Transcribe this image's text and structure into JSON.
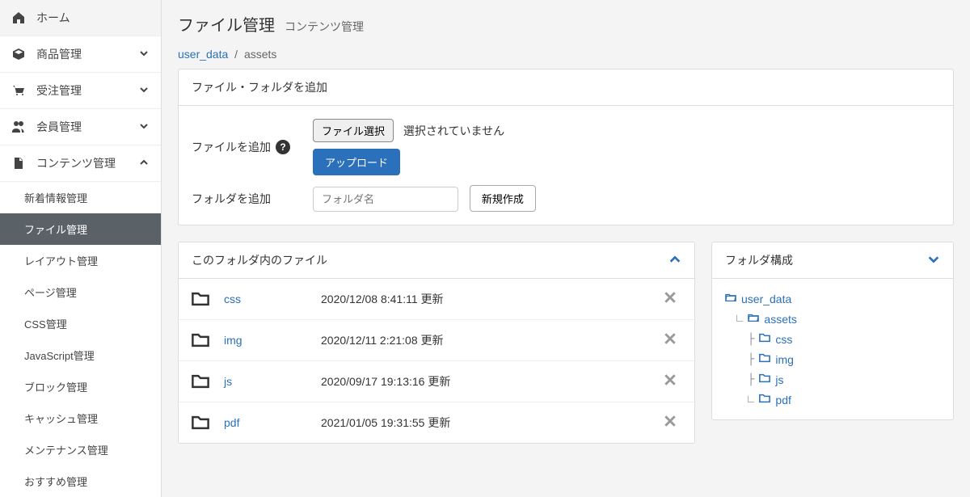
{
  "sidebar": {
    "items": [
      {
        "label": "ホーム",
        "icon": "home"
      },
      {
        "label": "商品管理",
        "icon": "cube",
        "chev": "down"
      },
      {
        "label": "受注管理",
        "icon": "cart",
        "chev": "down"
      },
      {
        "label": "会員管理",
        "icon": "users",
        "chev": "down"
      },
      {
        "label": "コンテンツ管理",
        "icon": "file",
        "chev": "up"
      }
    ],
    "sub": [
      "新着情報管理",
      "ファイル管理",
      "レイアウト管理",
      "ページ管理",
      "CSS管理",
      "JavaScript管理",
      "ブロック管理",
      "キャッシュ管理",
      "メンテナンス管理",
      "おすすめ管理"
    ],
    "active_sub": 1
  },
  "header": {
    "title": "ファイル管理",
    "subtitle": "コンテンツ管理"
  },
  "breadcrumb": {
    "root": "user_data",
    "current": "assets"
  },
  "add_panel": {
    "title": "ファイル・フォルダを追加",
    "file_label": "ファイルを追加",
    "file_button": "ファイル選択",
    "file_status": "選択されていません",
    "upload_button": "アップロード",
    "folder_label": "フォルダを追加",
    "folder_placeholder": "フォルダ名",
    "folder_button": "新規作成"
  },
  "files_panel": {
    "title": "このフォルダ内のファイル",
    "rows": [
      {
        "name": "css",
        "date": "2020/12/08 8:41:11 更新"
      },
      {
        "name": "img",
        "date": "2020/12/11 2:21:08 更新"
      },
      {
        "name": "js",
        "date": "2020/09/17 19:13:16 更新"
      },
      {
        "name": "pdf",
        "date": "2021/01/05 19:31:55 更新"
      }
    ]
  },
  "tree_panel": {
    "title": "フォルダ構成",
    "root": "user_data",
    "l1": "assets",
    "l2": [
      "css",
      "img",
      "js",
      "pdf"
    ]
  }
}
